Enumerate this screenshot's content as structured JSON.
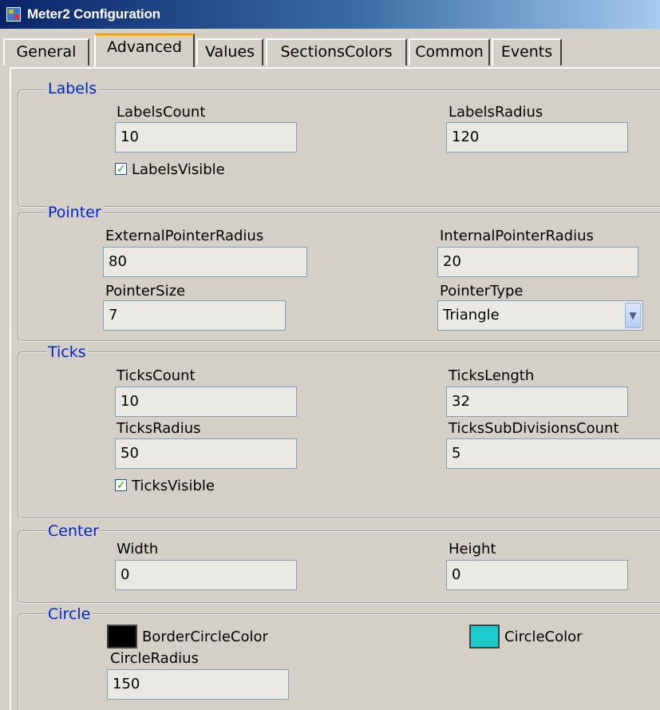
{
  "window": {
    "title": "Meter2 Configuration"
  },
  "tabs": [
    {
      "label": "General"
    },
    {
      "label": "Advanced"
    },
    {
      "label": "Values"
    },
    {
      "label": "SectionsColors"
    },
    {
      "label": "Common"
    },
    {
      "label": "Events"
    }
  ],
  "active_tab": "Advanced",
  "labels": {
    "title": "Labels",
    "count_label": "LabelsCount",
    "count_value": "10",
    "radius_label": "LabelsRadius",
    "radius_value": "120",
    "visible_label": "LabelsVisible",
    "visible_checked": true
  },
  "pointer": {
    "title": "Pointer",
    "external_radius_label": "ExternalPointerRadius",
    "external_radius_value": "80",
    "internal_radius_label": "InternalPointerRadius",
    "internal_radius_value": "20",
    "size_label": "PointerSize",
    "size_value": "7",
    "type_label": "PointerType",
    "type_value": "Triangle"
  },
  "ticks": {
    "title": "Ticks",
    "count_label": "TicksCount",
    "count_value": "10",
    "length_label": "TicksLength",
    "length_value": "32",
    "radius_label": "TicksRadius",
    "radius_value": "50",
    "subdivisions_label": "TicksSubDivisionsCount",
    "subdivisions_value": "5",
    "visible_label": "TicksVisible",
    "visible_checked": true
  },
  "center": {
    "title": "Center",
    "width_label": "Width",
    "width_value": "0",
    "height_label": "Height",
    "height_value": "0"
  },
  "circle": {
    "title": "Circle",
    "border_color_label": "BorderCircleColor",
    "border_color": "#000000",
    "color_label": "CircleColor",
    "color": "#1ccccc",
    "radius_label": "CircleRadius",
    "radius_value": "150"
  }
}
